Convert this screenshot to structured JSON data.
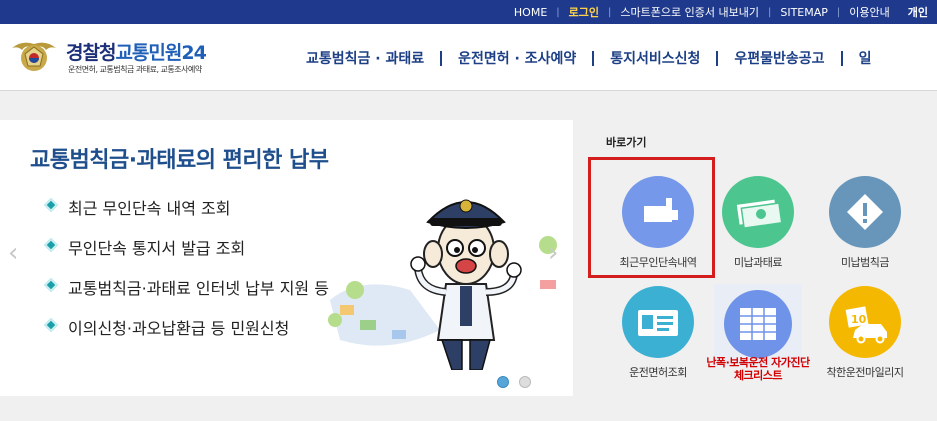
{
  "topbar": {
    "links": [
      "HOME",
      "로그인",
      "스마트폰으로 인증서 내보내기",
      "SITEMAP",
      "이용안내",
      "개인"
    ]
  },
  "header": {
    "brand_a": "경찰청",
    "brand_b": "교통민원24",
    "sub": "운전면허, 교통범칙금 과태료, 교통조사예약",
    "menu": [
      "교통범칙금 · 과태료",
      "운전면허 · 조사예약",
      "통지서비스신청",
      "우편물반송공고",
      "일"
    ]
  },
  "slider": {
    "title": "교통범칙금·과태료의 편리한 납부",
    "items": [
      "최근 무인단속 내역 조회",
      "무인단속 통지서 발급 조회",
      "교통범칙금·과태료 인터넷 납부 지원 등",
      "이의신청·과오납환급 등 민원신청"
    ],
    "prev": "‹",
    "next": "›"
  },
  "quick": {
    "title": "바로가기",
    "items": [
      {
        "label": "최근무인단속내역",
        "icon": "camera-icon",
        "color": "#6f93e8"
      },
      {
        "label": "미납과태료",
        "icon": "money-icon",
        "color": "#4cc58f"
      },
      {
        "label": "미납범칙금",
        "icon": "warning-icon",
        "color": "#5b8fb4"
      },
      {
        "label": "운전면허조회",
        "icon": "license-card-icon",
        "color": "#3cb0d2"
      },
      {
        "label": "난폭·보복운전 자가진단 체크리스트",
        "icon": "checklist-icon",
        "color": "#6f93e8"
      },
      {
        "label": "착한운전마일리지",
        "icon": "mileage-car-icon",
        "color": "#f5b800"
      }
    ]
  }
}
